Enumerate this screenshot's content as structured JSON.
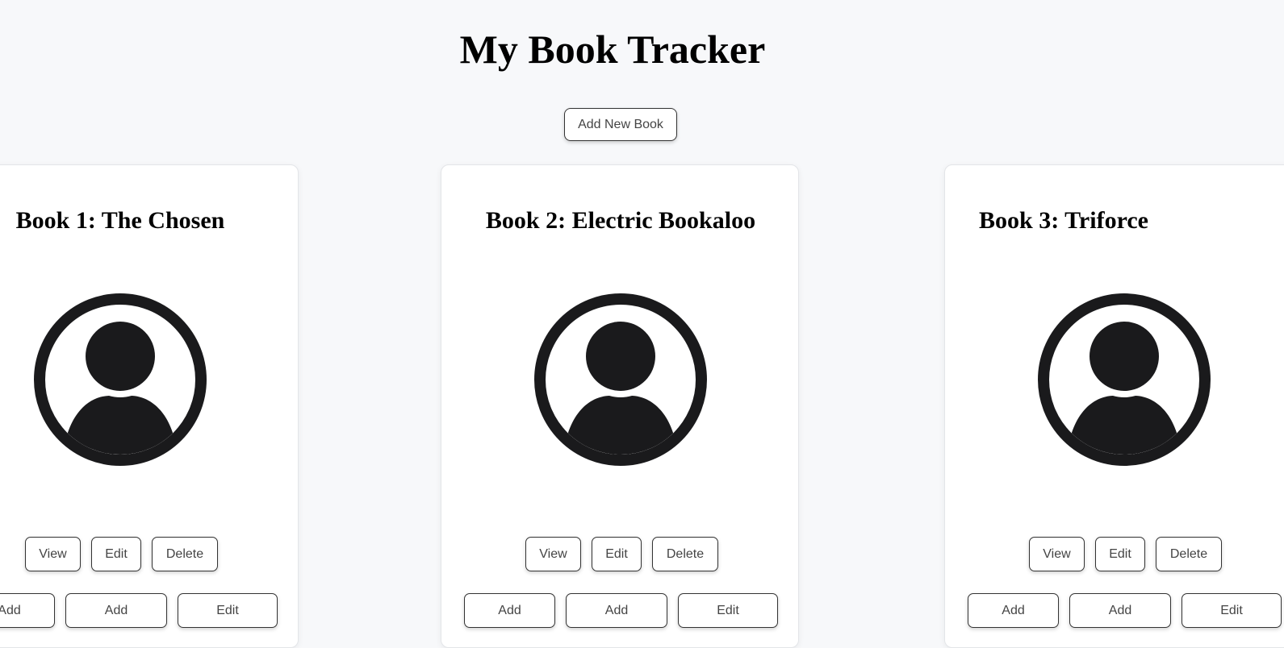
{
  "header": {
    "title": "My Book Tracker",
    "add_button_label": "Add New Book"
  },
  "books": [
    {
      "title": "Book 1: The Chosen",
      "icon": "user-avatar-icon",
      "actions": [
        "View",
        "Edit",
        "Delete"
      ],
      "secondary_actions": [
        "Add",
        "Add",
        "Edit"
      ]
    },
    {
      "title": "Book 2: Electric Bookaloo",
      "icon": "user-avatar-icon",
      "actions": [
        "View",
        "Edit",
        "Delete"
      ],
      "secondary_actions": [
        "Add",
        "Add",
        "Edit"
      ]
    },
    {
      "title": "Book 3: Triforce",
      "icon": "user-avatar-icon",
      "actions": [
        "View",
        "Edit",
        "Delete"
      ],
      "secondary_actions": [
        "Add",
        "Add",
        "Edit"
      ]
    }
  ],
  "colors": {
    "background": "#f7f8fa",
    "card": "#ffffff",
    "icon": "#1a1a1c",
    "button_border": "#333333",
    "button_text": "#444444"
  }
}
